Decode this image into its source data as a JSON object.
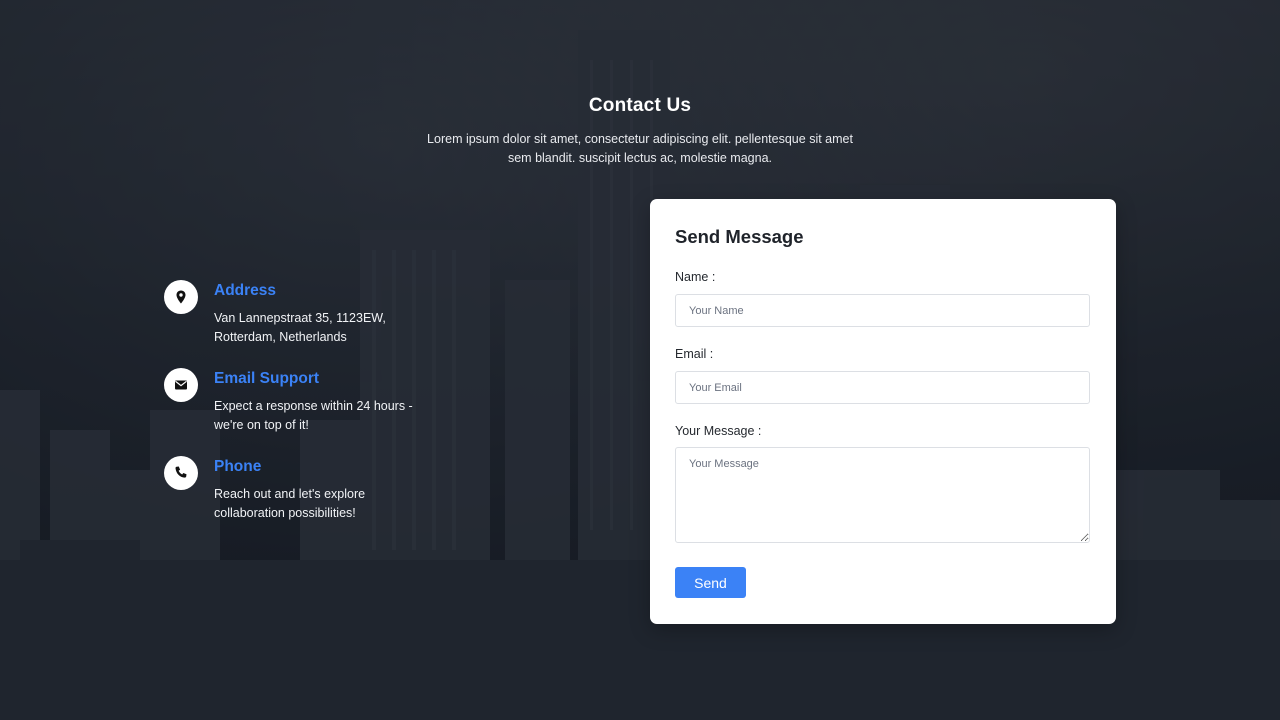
{
  "header": {
    "title": "Contact Us",
    "description": "Lorem ipsum dolor sit amet, consectetur adipiscing elit. pellentesque sit amet sem blandit. suscipit lectus ac, molestie magna."
  },
  "info": [
    {
      "icon": "location-pin-icon",
      "title": "Address",
      "text": "Van Lannepstraat 35, 1123EW, Rotterdam, Netherlands"
    },
    {
      "icon": "envelope-icon",
      "title": "Email Support",
      "text": "Expect a response within 24 hours - we're on top of it!"
    },
    {
      "icon": "phone-icon",
      "title": "Phone",
      "text": "Reach out and let's explore collaboration possibilities!"
    }
  ],
  "form": {
    "title": "Send Message",
    "name_label": "Name :",
    "name_placeholder": "Your Name",
    "email_label": "Email :",
    "email_placeholder": "Your Email",
    "message_label": "Your Message :",
    "message_placeholder": "Your Message",
    "send_label": "Send"
  },
  "colors": {
    "accent": "#3b82f6",
    "card": "#ffffff",
    "overlay": "#0a101c"
  }
}
